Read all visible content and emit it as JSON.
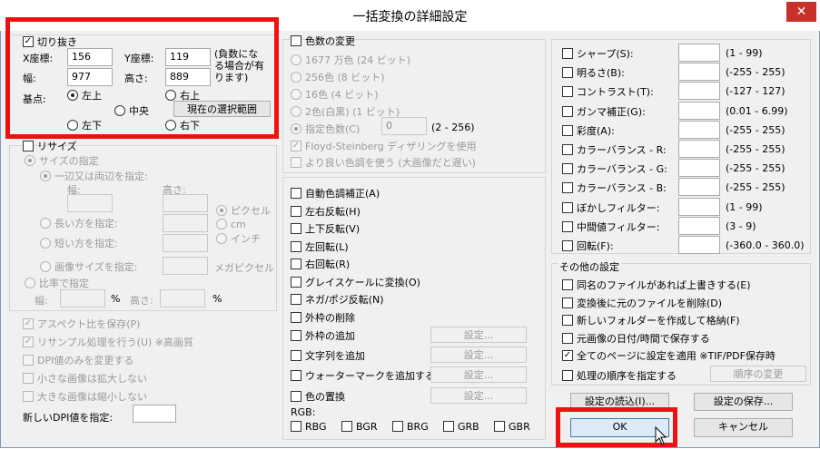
{
  "window": {
    "title": "一括変換の詳細設定",
    "close": "✕"
  },
  "crop": {
    "label": "切り抜き",
    "x_label": "X座標:",
    "x_value": "156",
    "y_label": "Y座標:",
    "y_value": "119",
    "note": "(負数になる場合が有ります)",
    "w_label": "幅:",
    "w_value": "977",
    "h_label": "高さ:",
    "h_value": "889",
    "anchor_label": "基点:",
    "top_left": "左上",
    "top_right": "右上",
    "center": "中央",
    "bottom_left": "左下",
    "bottom_right": "右下",
    "current_selection": "現在の選択範囲"
  },
  "resize": {
    "label": "リサイズ",
    "size_spec": "サイズの指定",
    "one_or_both": "一辺又は両辺を指定:",
    "width": "幅:",
    "height": "高さ:",
    "longer": "長い方を指定:",
    "shorter": "短い方を指定:",
    "image_size": "画像サイズを指定:",
    "unit_px": "ピクセル",
    "unit_cm": "cm",
    "unit_inch": "インチ",
    "unit_mp": "メガピクセル",
    "ratio_spec": "比率で指定",
    "ratio_w": "幅:",
    "ratio_h": "高さ:",
    "pct": "%",
    "keep_aspect": "アスペクト比を保存(P)",
    "resample": "リサンプル処理を行う(U) ※高画質",
    "dpi_only": "DPI値のみを変更する",
    "enlarge_small": "小さな画像は拡大しない",
    "shrink_large": "大きな画像は縮小しない",
    "new_dpi": "新しいDPI値を指定:"
  },
  "colors": {
    "label": "色数の変更",
    "c1677": "1677 万色 (24 ビット)",
    "c256": "256色 (8 ビット)",
    "c16": "16色 (4 ビット)",
    "c2": "2色(白黒) (1 ビット)",
    "custom": "指定色数(C)",
    "custom_value": "0",
    "custom_range": "(2 - 256)",
    "dither": "Floyd-Steinberg ディザリングを使用",
    "better": "より良い色調を使う (大画像だと遅い)"
  },
  "ops": {
    "auto_color": "自動色調補正(A)",
    "flip_h": "左右反転(H)",
    "flip_v": "上下反転(V)",
    "rot_left": "左回転(L)",
    "rot_right": "右回転(R)",
    "gray": "グレイスケールに変換(O)",
    "nega": "ネガ/ポジ反転(N)",
    "remove_frame": "外枠の削除",
    "add_frame": "外枠の追加",
    "add_text": "文字列を追加",
    "add_watermark": "ウォーターマークを追加する(W)",
    "replace_color": "色の置換",
    "settings": "設定...",
    "rgb": "RGB:",
    "rgb_options": [
      "RBG",
      "BGR",
      "BRG",
      "GRB",
      "GBR"
    ]
  },
  "adjust": [
    {
      "label": "シャープ(S):",
      "value": "",
      "range": "(1 - 99)"
    },
    {
      "label": "明るさ(B):",
      "value": "",
      "range": "(-255 - 255)"
    },
    {
      "label": "コントラスト(T):",
      "value": "",
      "range": "(-127 - 127)"
    },
    {
      "label": "ガンマ補正(G):",
      "value": "",
      "range": "(0.01 - 6.99)"
    },
    {
      "label": "彩度(A):",
      "value": "",
      "range": "(-255 - 255)"
    },
    {
      "label": "カラーバランス - R:",
      "value": "",
      "range": "(-255 - 255)"
    },
    {
      "label": "カラーバランス - G:",
      "value": "",
      "range": "(-255 - 255)"
    },
    {
      "label": "カラーバランス - B:",
      "value": "",
      "range": "(-255 - 255)"
    },
    {
      "label": "ぼかしフィルター:",
      "value": "",
      "range": "(1 - 99)"
    },
    {
      "label": "中間値フィルター:",
      "value": "",
      "range": "(3 - 9)"
    },
    {
      "label": "回転(F):",
      "value": "",
      "range": "(-360.0 - 360.0)"
    }
  ],
  "other": {
    "label": "その他の設定",
    "overwrite": "同名のファイルがあれば上書きする(E)",
    "delete_orig": "変換後に元のファイルを削除(D)",
    "new_folder": "新しいフォルダーを作成して格納(F)",
    "keep_date": "元画像の日付/時間で保存する",
    "all_pages": "全てのページに設定を適用 ※TIF/PDF保存時",
    "order": "処理の順序を指定する",
    "order_btn": "順序の変更"
  },
  "footer": {
    "load": "設定の読込(I)...",
    "save": "設定の保存...",
    "ok": "OK",
    "cancel": "キャンセル"
  },
  "highlight_color": "#ee1111"
}
